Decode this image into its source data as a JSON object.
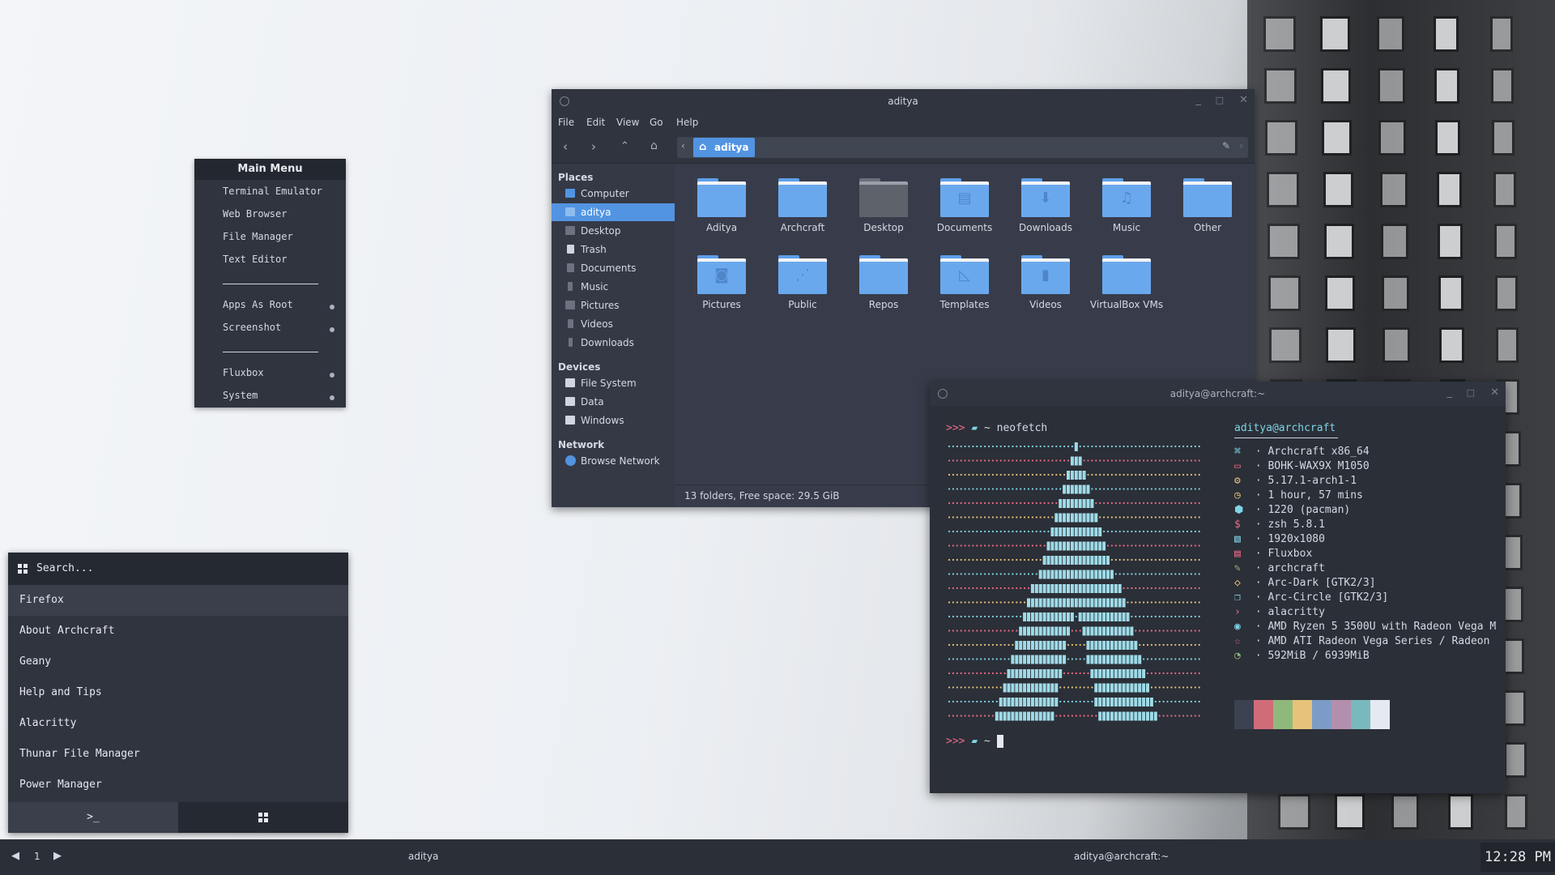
{
  "main_menu": {
    "title": "Main Menu",
    "items": [
      "Terminal Emulator",
      "Web Browser",
      "File Manager",
      "Text Editor"
    ],
    "root_items": [
      "Apps As Root",
      "Screenshot"
    ],
    "wm_items": [
      "Fluxbox",
      "System"
    ]
  },
  "file_manager": {
    "title": "aditya",
    "menu": [
      "File",
      "Edit",
      "View",
      "Go",
      "Help"
    ],
    "path_crumb": "aditya",
    "sidebar": {
      "places_header": "Places",
      "places": [
        "Computer",
        "aditya",
        "Desktop",
        "Trash",
        "Documents",
        "Music",
        "Pictures",
        "Videos",
        "Downloads"
      ],
      "devices_header": "Devices",
      "devices": [
        "File System",
        "Data",
        "Windows"
      ],
      "network_header": "Network",
      "network": [
        "Browse Network"
      ]
    },
    "folders": [
      {
        "label": "Aditya",
        "icon": "folder-icon"
      },
      {
        "label": "Archcraft",
        "icon": "folder-icon"
      },
      {
        "label": "Desktop",
        "icon": "folder-desktop-icon"
      },
      {
        "label": "Documents",
        "icon": "folder-documents-icon"
      },
      {
        "label": "Downloads",
        "icon": "folder-download-icon"
      },
      {
        "label": "Music",
        "icon": "folder-music-icon"
      },
      {
        "label": "Other",
        "icon": "folder-icon"
      },
      {
        "label": "Pictures",
        "icon": "folder-pictures-icon"
      },
      {
        "label": "Public",
        "icon": "folder-publicshare-icon"
      },
      {
        "label": "Repos",
        "icon": "folder-icon"
      },
      {
        "label": "Templates",
        "icon": "folder-templates-icon"
      },
      {
        "label": "Videos",
        "icon": "folder-videos-icon"
      },
      {
        "label": "VirtualBox VMs",
        "icon": "folder-icon"
      }
    ],
    "status": "13 folders, Free space: 29.5 GiB"
  },
  "terminal": {
    "title": "aditya@archcraft:~",
    "command_prompt": ">>>",
    "cwd": "~",
    "command": "neofetch",
    "user_host": "aditya@archcraft",
    "info": [
      "Archcraft x86_64",
      "BOHK-WAX9X M1050",
      "5.17.1-arch1-1",
      "1 hour, 57 mins",
      "1220 (pacman)",
      "zsh 5.8.1",
      "1920x1080",
      "Fluxbox",
      "archcraft",
      "Arc-Dark [GTK2/3]",
      "Arc-Circle [GTK2/3]",
      "alacritty",
      "AMD Ryzen 5 3500U with Radeon Vega M",
      "AMD ATI Radeon Vega Series / Radeon",
      "592MiB / 6939MiB"
    ],
    "info_separator": "·",
    "palette": [
      "#3b4252",
      "#d06c78",
      "#8fb97c",
      "#e6c27a",
      "#7c9cc7",
      "#b48ead",
      "#79b9bd",
      "#e5e9f0"
    ]
  },
  "launcher": {
    "search_placeholder": "Search...",
    "entries": [
      "Firefox",
      "About Archcraft",
      "Geany",
      "Help and Tips",
      "Alacritty",
      "Thunar File Manager",
      "Power Manager"
    ],
    "selected_index": 0,
    "mode_run": ">_",
    "mode_apps": "apps-grid"
  },
  "taskbar": {
    "workspace": "1",
    "task1": "aditya",
    "task2": "aditya@archcraft:~",
    "clock": "12:28 PM"
  },
  "colors": {
    "accent": "#5294e2",
    "panel": "#2f343f",
    "terminal_bg": "#2b2f37",
    "prompt_red": "#ec6a88",
    "terminal_cyan": "#7fd4e6"
  }
}
